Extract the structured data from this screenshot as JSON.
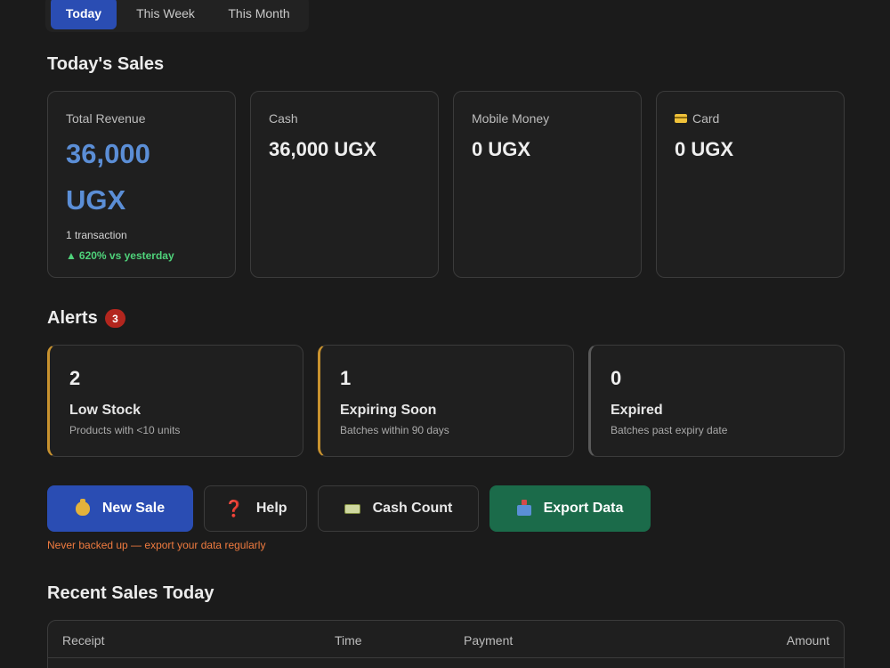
{
  "period_tabs": [
    "Today",
    "This Week",
    "This Month"
  ],
  "sections": {
    "todays_sales": "Today's Sales",
    "alerts": "Alerts",
    "recent_sales": "Recent Sales Today"
  },
  "stats": {
    "total_revenue": {
      "label": "Total Revenue",
      "value_line1": "36,000",
      "value_line2": "UGX",
      "transactions": "1 transaction",
      "trend_arrow": "▲",
      "trend": "620% vs yesterday"
    },
    "cash": {
      "label": "Cash",
      "value": "36,000 UGX"
    },
    "mobile_money": {
      "label": "Mobile Money",
      "value": "0 UGX"
    },
    "card": {
      "label": "Card",
      "value": "0 UGX",
      "icon": "credit-card-icon"
    }
  },
  "alerts_badge": "3",
  "alerts": [
    {
      "count": "2",
      "title": "Low Stock",
      "desc": "Products with <10 units"
    },
    {
      "count": "1",
      "title": "Expiring Soon",
      "desc": "Batches within 90 days"
    },
    {
      "count": "0",
      "title": "Expired",
      "desc": "Batches past expiry date"
    }
  ],
  "actions": {
    "new_sale": "New Sale",
    "help": "Help",
    "help_icon": "❓",
    "cash_count": "Cash Count",
    "export": "Export Data"
  },
  "backup_warning": "Never backed up — export your data regularly",
  "table": {
    "columns": [
      "Receipt",
      "Time",
      "Payment",
      "Amount"
    ]
  },
  "colors": {
    "background": "#1b1b1b",
    "accent_blue": "#2a4db3",
    "revenue_blue": "#5b8ed6",
    "trend_green": "#4fd27a",
    "export_green": "#1b6b4a",
    "alert_amber": "#c8922f",
    "badge_red": "#b3261e",
    "warning_orange": "#f07b3f"
  }
}
